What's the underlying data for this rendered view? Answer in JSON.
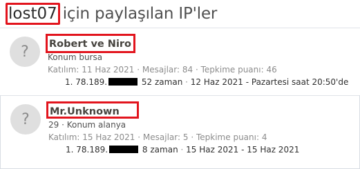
{
  "header": {
    "username": "lost07",
    "title_rest": "için paylaşılan IP'ler"
  },
  "users": [
    {
      "name": "Robert ve Niro",
      "blurb": "Konum bursa",
      "meta": {
        "joined_label": "Katılım:",
        "joined": "11 Haz 2021",
        "messages_label": "Mesajlar:",
        "messages": "84",
        "reaction_label": "Tepkime puanı:",
        "reaction": "46"
      },
      "ip": {
        "index": "1.",
        "prefix": "78.189.",
        "count_text": "52 zaman",
        "date_range": "12 Haz 2021 - Pazartesi saat 20:50'de"
      }
    },
    {
      "name": "Mr.Unknown",
      "blurb": "29 · Konum alanya",
      "meta": {
        "joined_label": "Katılım:",
        "joined": "15 Haz 2021",
        "messages_label": "Mesajlar:",
        "messages": "5",
        "reaction_label": "Tepkime puanı:",
        "reaction": "4"
      },
      "ip": {
        "index": "1.",
        "prefix": "78.189.",
        "count_text": "8 zaman",
        "date_range": "15 Haz 2021 - 15 Haz 2021"
      }
    }
  ],
  "colors": {
    "highlight_red": "#e2141d",
    "avatar_bg": "#dfdfdf",
    "muted_text": "#8c8c8c"
  },
  "icons": {
    "avatar_placeholder": "?"
  }
}
